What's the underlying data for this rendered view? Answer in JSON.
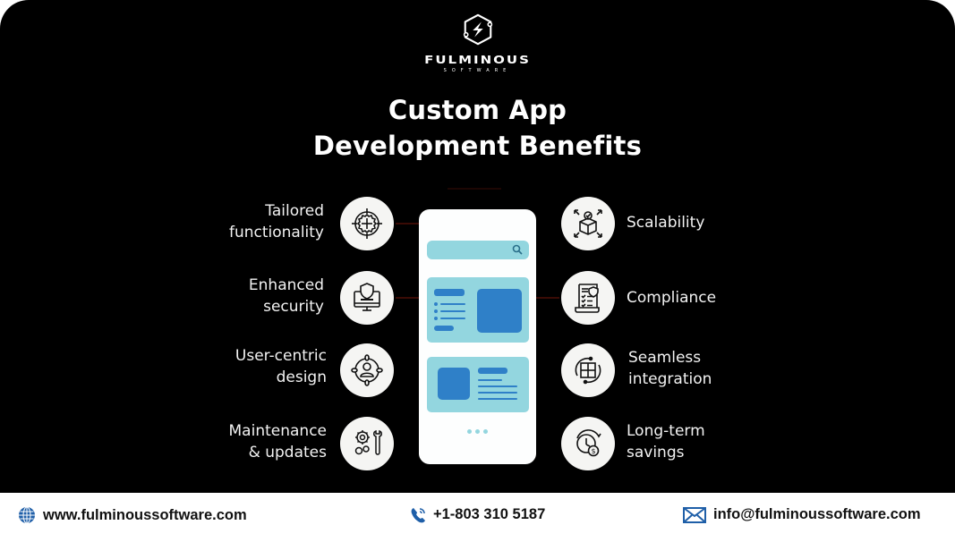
{
  "brand": {
    "name": "FULMINOUS",
    "tagline": "SOFTWARE",
    "logo_icon": "hexagon-lightning-icon"
  },
  "title": {
    "line1": "Custom App",
    "line2": "Development Benefits"
  },
  "benefits_left": [
    {
      "line1": "Tailored",
      "line2": "functionality",
      "icon": "target-gear-icon"
    },
    {
      "line1": "Enhanced",
      "line2": "security",
      "icon": "monitor-shield-icon"
    },
    {
      "line1": "User-centric",
      "line2": "design",
      "icon": "user-target-icon"
    },
    {
      "line1": "Maintenance",
      "line2": "& updates",
      "icon": "gears-wrench-icon"
    }
  ],
  "benefits_right": [
    {
      "line1": "Scalability",
      "line2": "",
      "icon": "box-expand-icon"
    },
    {
      "line1": "Compliance",
      "line2": "",
      "icon": "document-checklist-icon"
    },
    {
      "line1": "Seamless",
      "line2": "integration",
      "icon": "puzzle-sync-icon"
    },
    {
      "line1": "Long-term",
      "line2": "savings",
      "icon": "clock-dollar-icon"
    }
  ],
  "phone": {
    "search_icon": "search-icon"
  },
  "colors": {
    "background": "#000000",
    "phone_accent": "#93d6df",
    "phone_block": "#2f80c8",
    "footer_icon": "#1f5fa8"
  },
  "footer": {
    "website": "www.fulminoussoftware.com",
    "phone": "+1-803 310 5187",
    "email": "info@fulminoussoftware.com"
  }
}
